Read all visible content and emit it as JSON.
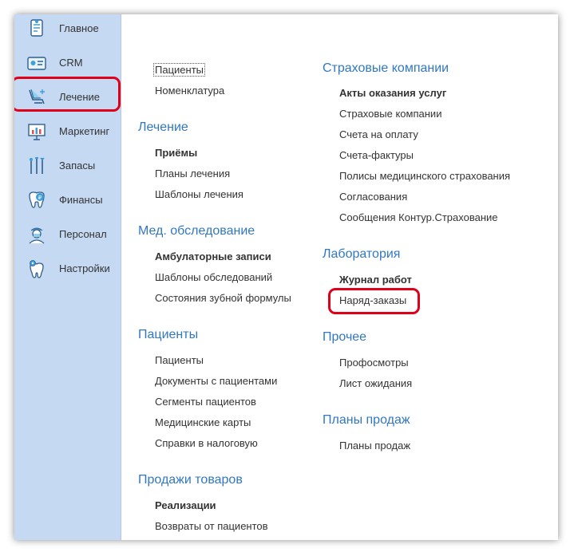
{
  "sidebar": {
    "items": [
      {
        "label": "Главное",
        "icon": "home-document-icon"
      },
      {
        "label": "CRM",
        "icon": "crm-card-icon"
      },
      {
        "label": "Лечение",
        "icon": "dental-chair-icon"
      },
      {
        "label": "Маркетинг",
        "icon": "chart-board-icon"
      },
      {
        "label": "Запасы",
        "icon": "dental-tools-icon"
      },
      {
        "label": "Финансы",
        "icon": "tooth-coin-icon"
      },
      {
        "label": "Персонал",
        "icon": "doctor-icon"
      },
      {
        "label": "Настройки",
        "icon": "tooth-gear-icon"
      }
    ],
    "selected": "Лечение"
  },
  "left_column": {
    "top_links": [
      "Пациенты",
      "Номенклатура"
    ],
    "sections": [
      {
        "title": "Лечение",
        "items": [
          "Приёмы",
          "Планы лечения",
          "Шаблоны лечения"
        ]
      },
      {
        "title": "Мед. обследование",
        "items": [
          "Амбулаторные записи",
          "Шаблоны обследований",
          "Состояния зубной формулы"
        ]
      },
      {
        "title": "Пациенты",
        "items": [
          "Пациенты",
          "Документы с пациентами",
          "Сегменты пациентов",
          "Медицинские карты",
          "Справки в налоговую"
        ]
      },
      {
        "title": "Продажи товаров",
        "items": [
          "Реализации",
          "Возвраты от пациентов"
        ]
      }
    ]
  },
  "right_column": {
    "sections": [
      {
        "title": "Страховые компании",
        "items": [
          "Акты оказания услуг",
          "Страховые компании",
          "Счета на оплату",
          "Счета-фактуры",
          "Полисы медицинского страхования",
          "Согласования",
          "Сообщения Контур.Страхование"
        ]
      },
      {
        "title": "Лаборатория",
        "items": [
          "Журнал работ",
          "Наряд-заказы"
        ]
      },
      {
        "title": "Прочее",
        "items": [
          "Профосмотры",
          "Лист ожидания"
        ]
      },
      {
        "title": "Планы продаж",
        "items": [
          "Планы продаж"
        ]
      }
    ]
  },
  "colors": {
    "sidebar_bg": "#c6d9f2",
    "section_title": "#3277c2",
    "highlight": "#e1001a"
  }
}
